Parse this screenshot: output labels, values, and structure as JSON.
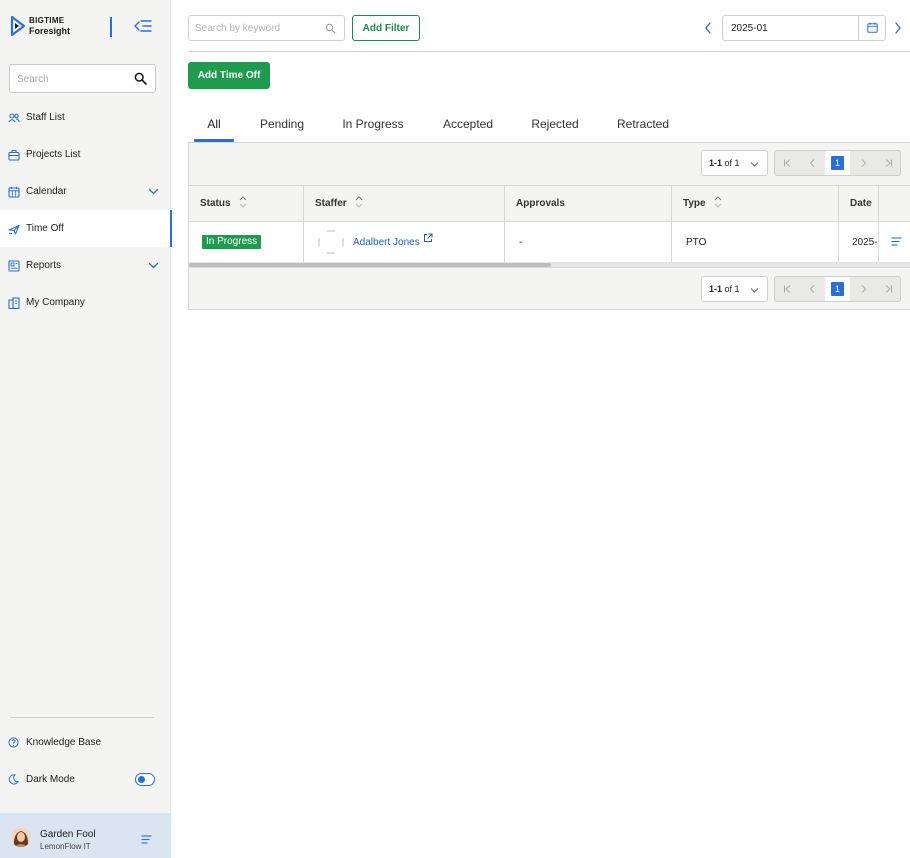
{
  "brand": {
    "line1": "BIGTIME",
    "line2": "Foresight"
  },
  "sidebar": {
    "search_placeholder": "Search",
    "items": [
      {
        "label": "Staff List",
        "icon": "people-icon",
        "has_chevron": false
      },
      {
        "label": "Projects List",
        "icon": "briefcase-icon",
        "has_chevron": false
      },
      {
        "label": "Calendar",
        "icon": "calendar-icon",
        "has_chevron": true
      },
      {
        "label": "Time Off",
        "icon": "plane-icon",
        "has_chevron": false,
        "active": true
      },
      {
        "label": "Reports",
        "icon": "report-icon",
        "has_chevron": true
      },
      {
        "label": "My Company",
        "icon": "building-icon",
        "has_chevron": false
      }
    ],
    "knowledge_base": "Knowledge Base",
    "dark_mode": "Dark Mode",
    "dark_mode_on": true
  },
  "user": {
    "name": "Garden Fool",
    "org": "LemonFlow IT"
  },
  "toolbar": {
    "search_placeholder": "Search by keyword",
    "add_filter": "Add Filter",
    "month": "2025-01",
    "add_time_off": "Add Time Off"
  },
  "tabs": [
    {
      "label": "All",
      "active": true
    },
    {
      "label": "Pending"
    },
    {
      "label": "In Progress"
    },
    {
      "label": "Accepted"
    },
    {
      "label": "Rejected"
    },
    {
      "label": "Retracted"
    }
  ],
  "pager": {
    "range": "1-1",
    "of_label": "of 1",
    "current_page": "1"
  },
  "table": {
    "columns": [
      "Status",
      "Staffer",
      "Approvals",
      "Type",
      "Date"
    ],
    "rows": [
      {
        "status": "In Progress",
        "staffer": "Adalbert Jones",
        "approvals": "-",
        "type": "PTO",
        "date": "2025-"
      }
    ]
  },
  "colors": {
    "accent": "#2a6fd6",
    "success": "#1f9a4e",
    "sidebar_bg": "#f4f4f2",
    "user_bg": "#dbe5f2"
  }
}
